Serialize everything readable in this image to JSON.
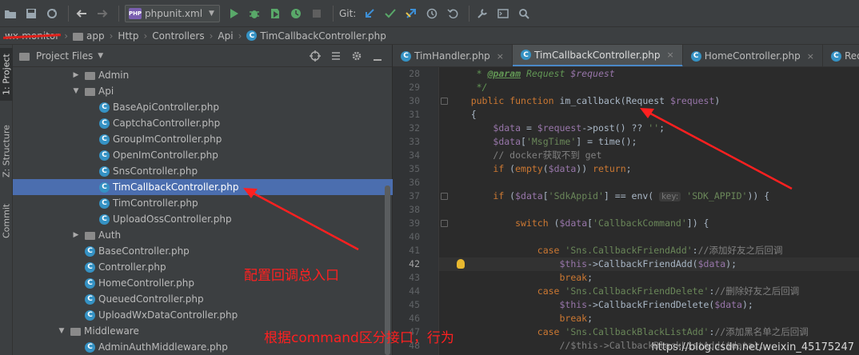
{
  "toolbar": {
    "run_config_label": "phpunit.xml",
    "git_label": "Git:",
    "icons": [
      "open-folder-icon",
      "save-icon",
      "sync-icon",
      "back-icon",
      "forward-icon",
      "run-icon",
      "debug-icon",
      "coverage-icon",
      "profile-icon",
      "stop-icon",
      "git-update-icon",
      "git-commit-icon",
      "git-push-icon",
      "history-icon",
      "rollback-icon",
      "settings-wrench-icon",
      "terminal-icon",
      "search-icon"
    ]
  },
  "breadcrumb": {
    "root": "wx-monitor",
    "items": [
      "app",
      "Http",
      "Controllers",
      "Api",
      "TimCallbackController.php"
    ]
  },
  "side_tabs": {
    "project": "1: Project",
    "structure": "Z: Structure",
    "commit": "Commit"
  },
  "project_panel": {
    "title": "Project Files",
    "tree": [
      {
        "label": "Admin",
        "type": "folder",
        "expanded": false,
        "depth": 1
      },
      {
        "label": "Api",
        "type": "folder",
        "expanded": true,
        "depth": 1
      },
      {
        "label": "BaseApiController.php",
        "type": "class",
        "depth": 2
      },
      {
        "label": "CaptchaController.php",
        "type": "class",
        "depth": 2
      },
      {
        "label": "GroupImController.php",
        "type": "class",
        "depth": 2
      },
      {
        "label": "OpenImController.php",
        "type": "class",
        "depth": 2
      },
      {
        "label": "SnsController.php",
        "type": "class",
        "depth": 2
      },
      {
        "label": "TimCallbackController.php",
        "type": "class",
        "depth": 2,
        "selected": true
      },
      {
        "label": "TimController.php",
        "type": "class",
        "depth": 2
      },
      {
        "label": "UploadOssController.php",
        "type": "class",
        "depth": 2
      },
      {
        "label": "Auth",
        "type": "folder",
        "expanded": false,
        "depth": 1
      },
      {
        "label": "BaseController.php",
        "type": "class",
        "depth": 1
      },
      {
        "label": "Controller.php",
        "type": "class",
        "depth": 1
      },
      {
        "label": "HomeController.php",
        "type": "class",
        "depth": 1
      },
      {
        "label": "QueuedController.php",
        "type": "class",
        "depth": 1
      },
      {
        "label": "UploadWxDataController.php",
        "type": "class",
        "depth": 1
      },
      {
        "label": "Middleware",
        "type": "folder",
        "expanded": true,
        "depth": 0
      },
      {
        "label": "AdminAuthMiddleware.php",
        "type": "class",
        "depth": 1
      }
    ]
  },
  "editor_tabs": [
    {
      "label": "TimHandler.php",
      "active": false
    },
    {
      "label": "TimCallbackController.php",
      "active": true
    },
    {
      "label": "HomeController.php",
      "active": false
    },
    {
      "label": "RedisS",
      "active": false
    }
  ],
  "code": {
    "current_line": 42,
    "line_numbers": [
      28,
      29,
      30,
      31,
      32,
      33,
      34,
      35,
      36,
      37,
      38,
      39,
      40,
      41,
      42,
      43,
      44,
      45,
      46,
      47,
      48
    ],
    "lines": [
      "     * @param Request $request",
      "     */",
      "    public function im_callback(Request $request)",
      "    {",
      "        $data = $request->post() ?? '';",
      "        $data['MsgTime'] = time();",
      "        // docker获取不到 get",
      "        if (empty($data)) return;",
      "",
      "        if ($data['SdkAppid'] == env( key: 'SDK_APPID')) {",
      "",
      "            switch ($data['CallbackCommand']) {",
      "",
      "                case 'Sns.CallbackFriendAdd'://添加好友之后回调",
      "                    $this->CallbackFriendAdd($data);",
      "                    break;",
      "                case 'Sns.CallbackFriendDelete'://删除好友之后回调",
      "                    $this->CallbackFriendDelete($data);",
      "                    break;",
      "                case 'Sns.CallbackBlackListAdd'://添加黑名单之后回调",
      "                    //$this->CallbackBlackListAdd($data);"
    ]
  },
  "annotations": {
    "entry_note": "配置回调总入口",
    "command_note": "根据command区分接口，行为"
  },
  "watermark": "https://blog.csdn.net/weixin_45175247",
  "colors": {
    "selection": "#4b6eaf",
    "annotation_red": "#ff2020",
    "class_icon": "#3592c4"
  }
}
